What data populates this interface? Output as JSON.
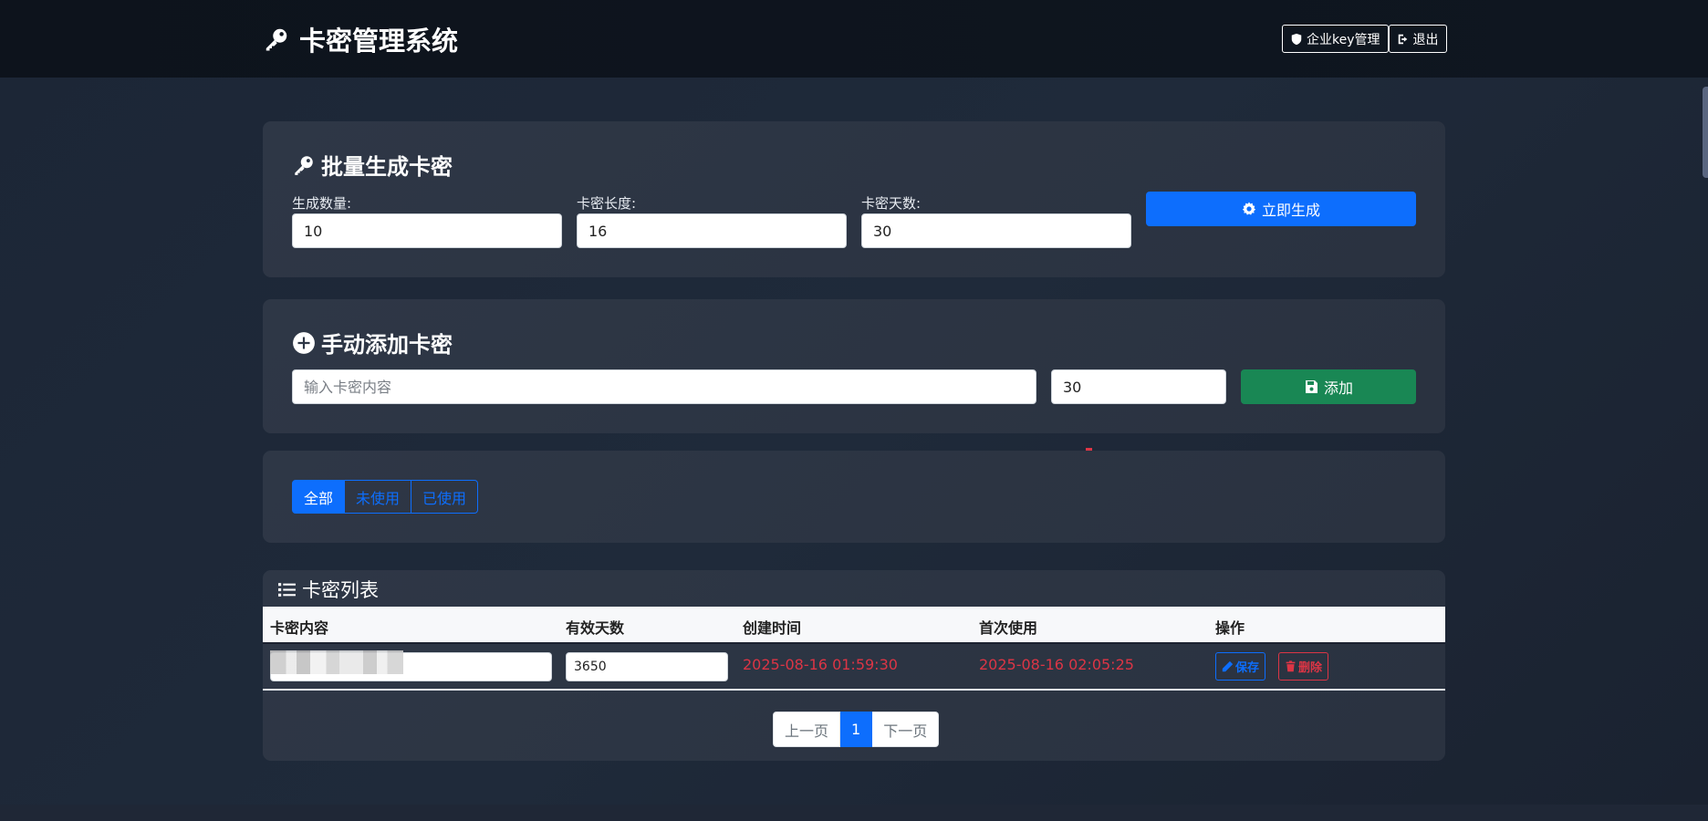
{
  "header": {
    "title": "卡密管理系统",
    "actions": {
      "key_manage": "企业key管理",
      "logout": "退出"
    }
  },
  "batch": {
    "title": "批量生成卡密",
    "count_label": "生成数量:",
    "count_value": "10",
    "length_label": "卡密长度:",
    "length_value": "16",
    "days_label": "卡密天数:",
    "days_value": "30",
    "generate_button": "立即生成"
  },
  "manual": {
    "title": "手动添加卡密",
    "content_placeholder": "输入卡密内容",
    "days_value": "30",
    "add_button": "添加"
  },
  "filters": {
    "items": [
      "全部",
      "未使用",
      "已使用"
    ],
    "active": "全部"
  },
  "list": {
    "title": "卡密列表",
    "columns": [
      "卡密内容",
      "有效天数",
      "创建时间",
      "首次使用",
      "操作"
    ],
    "rows": [
      {
        "content": "",
        "days": "3650",
        "created": "2025-08-16 01:59:30",
        "first_used": "2025-08-16 02:05:25",
        "save_label": "保存",
        "delete_label": "删除"
      }
    ]
  },
  "pagination": {
    "prev": "上一页",
    "current": "1",
    "next": "下一页"
  },
  "colors": {
    "primary": "#0d6efd",
    "success": "#198754",
    "danger": "#dc3545"
  }
}
